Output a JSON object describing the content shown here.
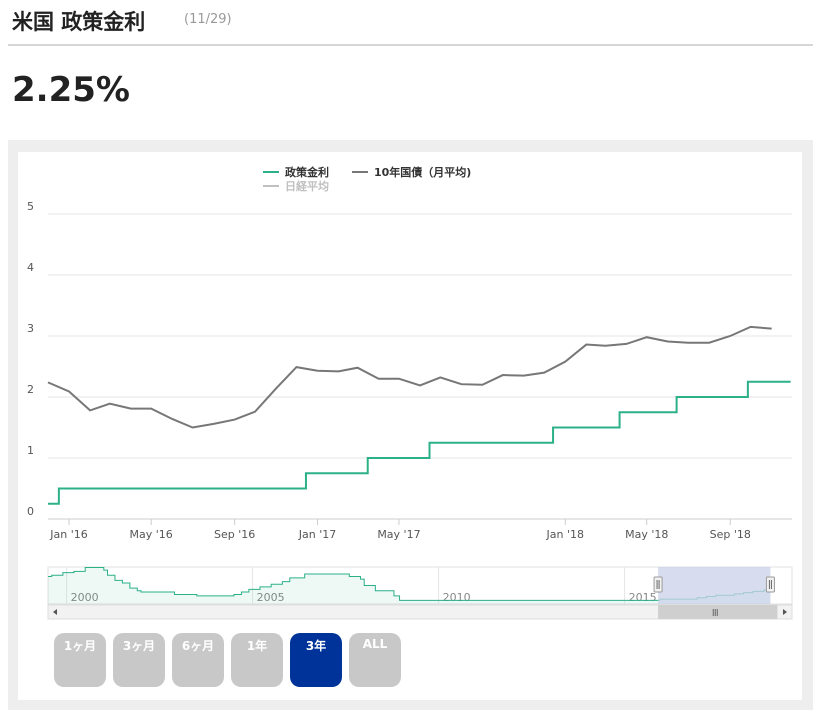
{
  "header": {
    "title": "米国 政策金利",
    "date": "(11/29)"
  },
  "current_value": "2.25%",
  "range_buttons": [
    {
      "label": "1ヶ月",
      "active": false
    },
    {
      "label": "3ヶ月",
      "active": false
    },
    {
      "label": "6ヶ月",
      "active": false
    },
    {
      "label": "1年",
      "active": false
    },
    {
      "label": "3年",
      "active": true
    },
    {
      "label": "ALL",
      "active": false
    }
  ],
  "colors": {
    "policy": "#2bb088",
    "bond": "#777777",
    "nikkei": "#c0c0c0",
    "active_button": "#003399",
    "navigator_window": "#c9d2e8"
  },
  "chart_data": {
    "type": "line",
    "legend": [
      {
        "name": "政策金利",
        "color": "#2bb088",
        "visible": true
      },
      {
        "name": "10年国債（月平均)",
        "color": "#777777",
        "visible": true
      },
      {
        "name": "日経平均",
        "color": "#c0c0c0",
        "visible": false
      }
    ],
    "legend_position": "top-center",
    "grid": true,
    "ylim": [
      0,
      5
    ],
    "yticks": [
      "0",
      "1",
      "2",
      "3",
      "4",
      "5"
    ],
    "xlim": [
      "2015-12-01",
      "2018-12-01"
    ],
    "xticks": [
      {
        "label": "Jan '16",
        "date": "2016-01-01"
      },
      {
        "label": "May '16",
        "date": "2016-05-01"
      },
      {
        "label": "Sep '16",
        "date": "2016-09-01"
      },
      {
        "label": "Jan '17",
        "date": "2017-01-01"
      },
      {
        "label": "May '17",
        "date": "2017-05-01"
      },
      {
        "label": "Jan '18",
        "date": "2018-01-01"
      },
      {
        "label": "May '18",
        "date": "2018-05-01"
      },
      {
        "label": "Sep '18",
        "date": "2018-09-01"
      }
    ],
    "series": [
      {
        "name": "政策金利",
        "step": true,
        "points": [
          [
            "2015-12-01",
            0.25
          ],
          [
            "2015-12-17",
            0.5
          ],
          [
            "2016-12-15",
            0.75
          ],
          [
            "2017-03-16",
            1.0
          ],
          [
            "2017-06-15",
            1.25
          ],
          [
            "2017-12-14",
            1.5
          ],
          [
            "2018-03-22",
            1.75
          ],
          [
            "2018-06-14",
            2.0
          ],
          [
            "2018-09-27",
            2.25
          ],
          [
            "2018-11-29",
            2.25
          ]
        ]
      },
      {
        "name": "10年国債（月平均)",
        "step": false,
        "points": [
          [
            "2015-12-01",
            2.24
          ],
          [
            "2016-01-01",
            2.09
          ],
          [
            "2016-02-01",
            1.78
          ],
          [
            "2016-03-01",
            1.89
          ],
          [
            "2016-04-01",
            1.81
          ],
          [
            "2016-05-01",
            1.81
          ],
          [
            "2016-06-01",
            1.64
          ],
          [
            "2016-07-01",
            1.5
          ],
          [
            "2016-08-01",
            1.56
          ],
          [
            "2016-09-01",
            1.63
          ],
          [
            "2016-10-01",
            1.76
          ],
          [
            "2016-11-01",
            2.14
          ],
          [
            "2016-12-01",
            2.49
          ],
          [
            "2017-01-01",
            2.43
          ],
          [
            "2017-02-01",
            2.42
          ],
          [
            "2017-03-01",
            2.48
          ],
          [
            "2017-04-01",
            2.3
          ],
          [
            "2017-05-01",
            2.3
          ],
          [
            "2017-06-01",
            2.19
          ],
          [
            "2017-07-01",
            2.32
          ],
          [
            "2017-08-01",
            2.21
          ],
          [
            "2017-09-01",
            2.2
          ],
          [
            "2017-10-01",
            2.36
          ],
          [
            "2017-11-01",
            2.35
          ],
          [
            "2017-12-01",
            2.4
          ],
          [
            "2018-01-01",
            2.58
          ],
          [
            "2018-02-01",
            2.86
          ],
          [
            "2018-03-01",
            2.84
          ],
          [
            "2018-04-01",
            2.87
          ],
          [
            "2018-05-01",
            2.98
          ],
          [
            "2018-06-01",
            2.91
          ],
          [
            "2018-07-01",
            2.89
          ],
          [
            "2018-08-01",
            2.89
          ],
          [
            "2018-09-01",
            3.0
          ],
          [
            "2018-10-01",
            3.15
          ],
          [
            "2018-11-01",
            3.12
          ]
        ]
      }
    ],
    "navigator": {
      "labels": [
        {
          "label": "2000",
          "year": 2000
        },
        {
          "label": "2005",
          "year": 2005
        },
        {
          "label": "2010",
          "year": 2010
        },
        {
          "label": "2015",
          "year": 2015
        }
      ],
      "range": [
        1999.5,
        2019.5
      ],
      "selected": [
        2015.9,
        2018.92
      ],
      "policy_history": [
        [
          1999.5,
          4.75
        ],
        [
          1999.6,
          5.0
        ],
        [
          1999.9,
          5.5
        ],
        [
          2000.2,
          5.75
        ],
        [
          2000.5,
          6.5
        ],
        [
          2001.0,
          6.0
        ],
        [
          2001.1,
          5.0
        ],
        [
          2001.3,
          4.0
        ],
        [
          2001.5,
          3.5
        ],
        [
          2001.7,
          2.5
        ],
        [
          2001.9,
          2.0
        ],
        [
          2002.0,
          1.75
        ],
        [
          2002.9,
          1.25
        ],
        [
          2003.5,
          1.0
        ],
        [
          2004.5,
          1.25
        ],
        [
          2004.7,
          1.75
        ],
        [
          2004.9,
          2.25
        ],
        [
          2005.2,
          2.75
        ],
        [
          2005.5,
          3.25
        ],
        [
          2005.8,
          3.75
        ],
        [
          2006.0,
          4.5
        ],
        [
          2006.4,
          5.25
        ],
        [
          2007.6,
          4.75
        ],
        [
          2007.9,
          4.25
        ],
        [
          2008.0,
          3.0
        ],
        [
          2008.3,
          2.0
        ],
        [
          2008.8,
          1.0
        ],
        [
          2008.95,
          0.125
        ],
        [
          2015.95,
          0.375
        ],
        [
          2016.95,
          0.625
        ],
        [
          2017.2,
          0.875
        ],
        [
          2017.45,
          1.125
        ],
        [
          2017.95,
          1.375
        ],
        [
          2018.2,
          1.625
        ],
        [
          2018.45,
          1.875
        ],
        [
          2018.75,
          2.125
        ],
        [
          2018.92,
          2.25
        ]
      ]
    }
  }
}
